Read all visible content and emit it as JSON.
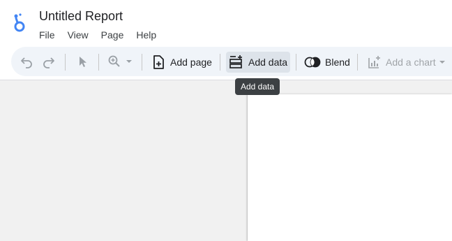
{
  "app": {
    "report_title": "Untitled Report",
    "logo_icon": "looker-studio-logo",
    "brand_color": "#4285f4"
  },
  "menu": {
    "items": [
      {
        "label": "File"
      },
      {
        "label": "View"
      },
      {
        "label": "Page"
      },
      {
        "label": "Help"
      }
    ]
  },
  "toolbar": {
    "undo_icon": "undo-icon",
    "redo_icon": "redo-icon",
    "select_icon": "pointer-icon",
    "zoom_icon": "zoom-in-icon",
    "add_page_label": "Add page",
    "add_data_label": "Add data",
    "blend_label": "Blend",
    "add_chart_label": "Add a chart"
  },
  "tooltip": {
    "text": "Add data"
  }
}
